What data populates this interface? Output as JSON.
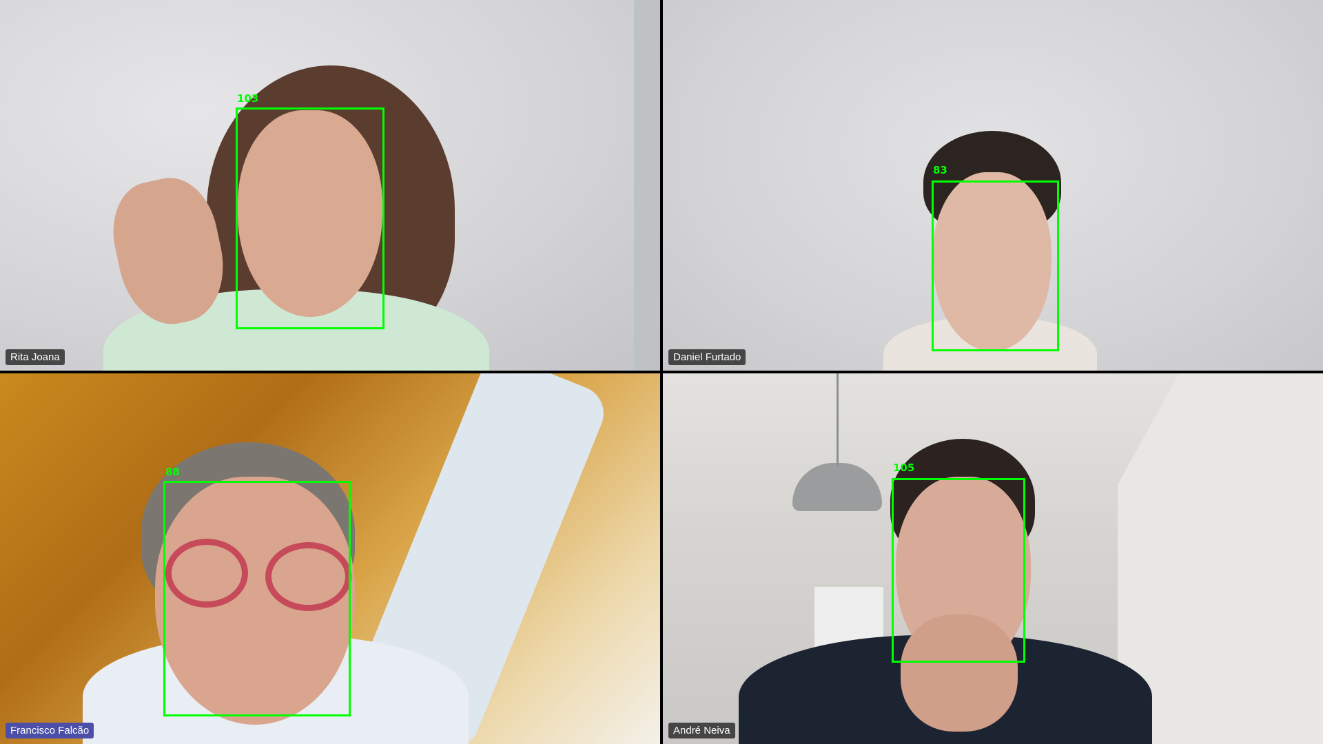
{
  "participants": [
    {
      "name": "Rita Joana",
      "face_score": "103",
      "speaking": false
    },
    {
      "name": "Daniel Furtado",
      "face_score": "83",
      "speaking": false
    },
    {
      "name": "Francisco Falcão",
      "face_score": "88",
      "speaking": true
    },
    {
      "name": "André Neiva",
      "face_score": "105",
      "speaking": false
    }
  ],
  "colors": {
    "detection_box": "#00ff00",
    "active_name_tag": "#4b4fa8",
    "name_tag": "#282828"
  }
}
